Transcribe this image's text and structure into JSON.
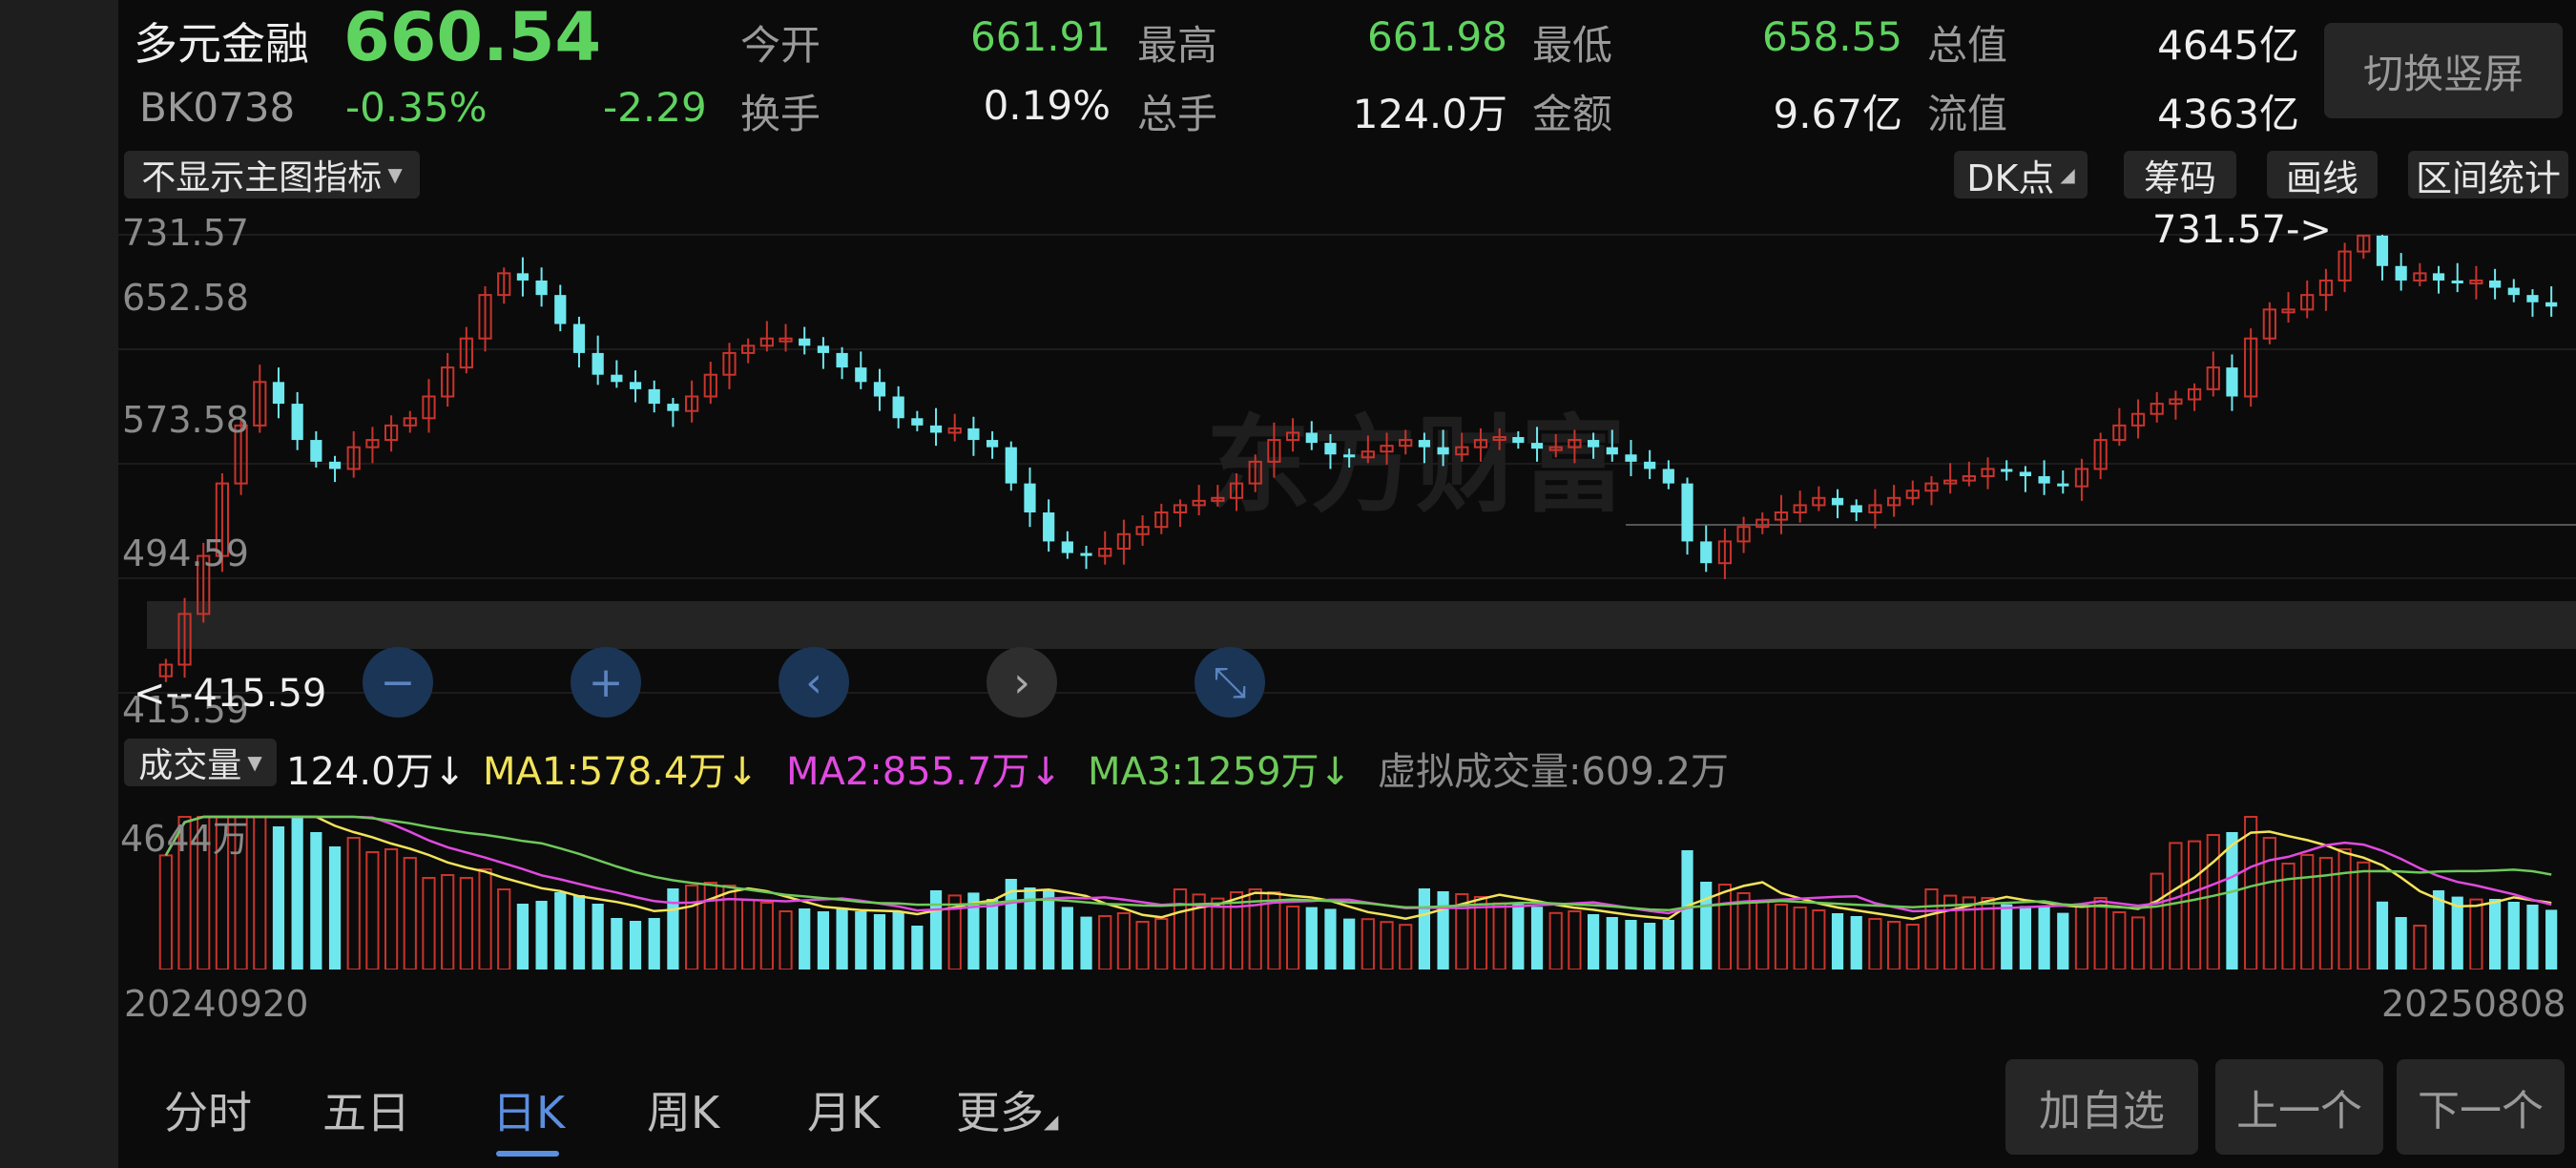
{
  "header": {
    "name": "多元金融",
    "price": "660.54",
    "code": "BK0738",
    "change_pct": "-0.35%",
    "change": "-2.29",
    "stats": [
      {
        "label": "今开",
        "value": "661.91",
        "color": "#5fd35f"
      },
      {
        "label": "最高",
        "value": "661.98",
        "color": "#5fd35f"
      },
      {
        "label": "最低",
        "value": "658.55",
        "color": "#5fd35f"
      },
      {
        "label": "总值",
        "value": "4645亿",
        "color": "#eeeeee"
      },
      {
        "label": "换手",
        "value": "0.19%",
        "color": "#eeeeee"
      },
      {
        "label": "总手",
        "value": "124.0万",
        "color": "#eeeeee"
      },
      {
        "label": "金额",
        "value": "9.67亿",
        "color": "#eeeeee"
      },
      {
        "label": "流值",
        "value": "4363亿",
        "color": "#eeeeee"
      }
    ],
    "switch_label": "切换竖屏"
  },
  "toolbar": {
    "indicator_select": "不显示主图指标",
    "dk_label": "DK点",
    "chips_label": "筹码",
    "draw_label": "画线",
    "range_label": "区间统计"
  },
  "price_axis": {
    "labels": [
      "731.57",
      "652.58",
      "573.58",
      "494.59",
      "415.59"
    ],
    "max_marker": "731.57->",
    "min_marker": "<--415.59",
    "watermark": "东方财富"
  },
  "controls": [
    {
      "name": "zoom-out-button",
      "icon": "minus-icon",
      "glyph": "−"
    },
    {
      "name": "zoom-in-button",
      "icon": "plus-icon",
      "glyph": "+"
    },
    {
      "name": "scroll-left-button",
      "icon": "chevron-left-icon",
      "glyph": "‹"
    },
    {
      "name": "scroll-right-button",
      "icon": "chevron-right-icon",
      "glyph": "›"
    },
    {
      "name": "reset-zoom-button",
      "icon": "compress-icon",
      "glyph": "⤡"
    }
  ],
  "volume": {
    "select": "成交量",
    "value": "124.0万↓",
    "ma1": "MA1:578.4万↓",
    "ma2": "MA2:855.7万↓",
    "ma3": "MA3:1259万↓",
    "virtual": "虚拟成交量:609.2万",
    "axis_max": "4644万",
    "date_start": "20240920",
    "date_end": "20250808"
  },
  "colors": {
    "up": "#c9342c",
    "down": "#6fe7ee",
    "ma1": "#f2e35a",
    "ma2": "#e04ae0",
    "ma3": "#6ec95a",
    "accent": "#5b8fe0"
  },
  "tabs": [
    {
      "label": "分时",
      "active": false
    },
    {
      "label": "五日",
      "active": false
    },
    {
      "label": "日K",
      "active": true
    },
    {
      "label": "周K",
      "active": false
    },
    {
      "label": "月K",
      "active": false
    },
    {
      "label": "更多",
      "active": false
    }
  ],
  "bottom_buttons": {
    "add": "加自选",
    "prev": "上一个",
    "next": "下一个"
  },
  "chart_data": {
    "type": "candlestick",
    "x_range": [
      "20240920",
      "20250808"
    ],
    "ylim": [
      415.59,
      731.57
    ],
    "series_close": [
      435,
      470,
      510,
      560,
      600,
      630,
      615,
      590,
      575,
      570,
      585,
      590,
      600,
      605,
      620,
      640,
      660,
      690,
      705,
      700,
      690,
      670,
      650,
      635,
      630,
      625,
      615,
      610,
      620,
      635,
      650,
      655,
      660,
      660,
      655,
      650,
      640,
      630,
      620,
      605,
      600,
      595,
      598,
      590,
      585,
      560,
      540,
      520,
      512,
      510,
      515,
      525,
      530,
      540,
      545,
      548,
      550,
      560,
      575,
      590,
      595,
      588,
      580,
      578,
      582,
      586,
      590,
      585,
      580,
      585,
      590,
      592,
      588,
      584,
      585,
      590,
      585,
      580,
      575,
      570,
      560,
      520,
      505,
      520,
      530,
      535,
      540,
      545,
      550,
      545,
      540,
      545,
      550,
      555,
      560,
      562,
      565,
      570,
      568,
      565,
      560,
      558,
      570,
      590,
      600,
      608,
      615,
      618,
      625,
      640,
      620,
      660,
      680,
      680,
      690,
      700,
      720,
      731,
      710,
      700,
      705,
      700,
      698,
      700,
      695,
      690,
      685,
      682
    ]
  }
}
